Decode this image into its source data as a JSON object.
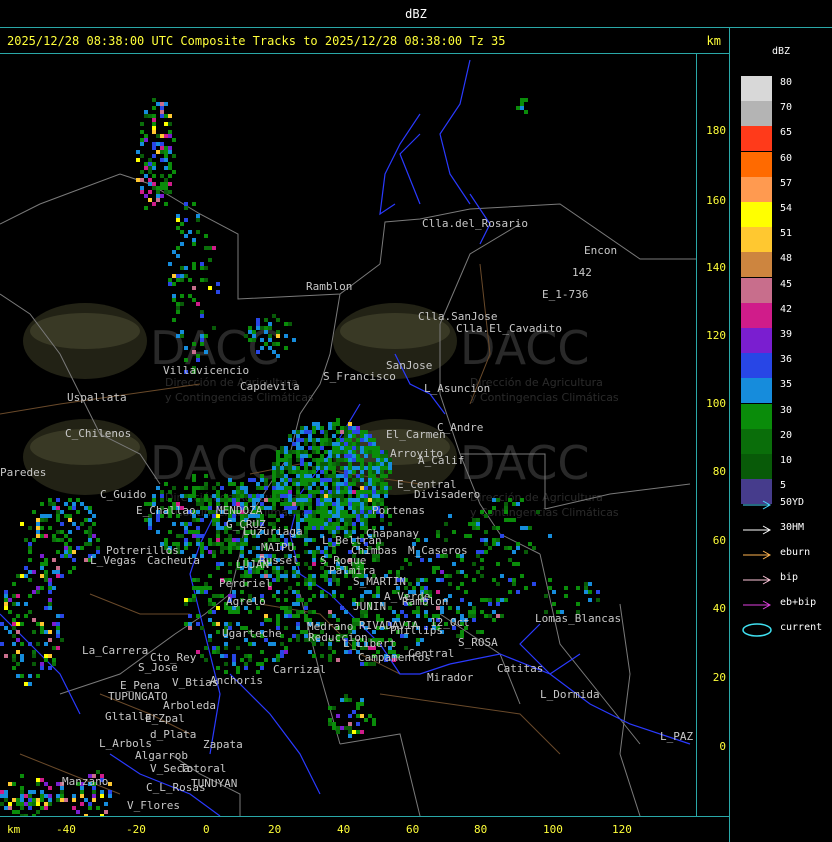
{
  "window": {
    "title": "dBZ"
  },
  "header": {
    "text": "2025/12/28 08:38:00 UTC Composite Tracks to 2025/12/28 08:38:00 Tz 35",
    "unit": "km"
  },
  "axes": {
    "y_ticks": [
      "180",
      "160",
      "140",
      "120",
      "100",
      "80",
      "60",
      "40",
      "20",
      "0"
    ],
    "x_ticks": [
      "-40",
      "-20",
      "0",
      "20",
      "40",
      "60",
      "80",
      "100",
      "120"
    ],
    "x_unit": "km"
  },
  "legend": {
    "title": "dBZ",
    "scale": [
      {
        "label": "80",
        "color": "#d8d8d8"
      },
      {
        "label": "70",
        "color": "#b4b4b4"
      },
      {
        "label": "65",
        "color": "#ff3a1a"
      },
      {
        "label": "60",
        "color": "#ff6a00"
      },
      {
        "label": "57",
        "color": "#ff9a50"
      },
      {
        "label": "54",
        "color": "#ffff00"
      },
      {
        "label": "51",
        "color": "#ffc830"
      },
      {
        "label": "48",
        "color": "#cd853f"
      },
      {
        "label": "45",
        "color": "#c86e8c"
      },
      {
        "label": "42",
        "color": "#d01c8a"
      },
      {
        "label": "39",
        "color": "#7a1ed0"
      },
      {
        "label": "36",
        "color": "#2846e6"
      },
      {
        "label": "35",
        "color": "#168cdc"
      },
      {
        "label": "30",
        "color": "#0a8c0a"
      },
      {
        "label": "20",
        "color": "#0a6e0a"
      },
      {
        "label": "10",
        "color": "#085a08"
      },
      {
        "label": "5",
        "color": "#463c8c"
      }
    ],
    "tracks": [
      {
        "label": "50YD",
        "color": "#4ad8ff"
      },
      {
        "label": "30HM",
        "color": "#ffffff"
      },
      {
        "label": "eburn",
        "color": "#ffb450"
      },
      {
        "label": "bip",
        "color": "#ffc8dc"
      },
      {
        "label": "eb+bip",
        "color": "#e040e0"
      },
      {
        "label": "current",
        "color": "#40e0f0"
      }
    ]
  },
  "watermark": {
    "brand": "DACC",
    "line1": "Dirección de Agricultura",
    "line2": "y Contingencias Climáticas"
  },
  "places": [
    {
      "name": "Clla.del_Rosario"
    },
    {
      "name": "Encon"
    },
    {
      "name": "142"
    },
    {
      "name": "E_1-736"
    },
    {
      "name": "Ramblon"
    },
    {
      "name": "Clla.SanJose"
    },
    {
      "name": "Clla.El_Cavadito"
    },
    {
      "name": "S_Francisco"
    },
    {
      "name": "Villavicencio"
    },
    {
      "name": "Capdevila"
    },
    {
      "name": "SanJose"
    },
    {
      "name": "L_Asuncion"
    },
    {
      "name": "Uspallata"
    },
    {
      "name": "C_Chilenos"
    },
    {
      "name": "C_Andre"
    },
    {
      "name": "El_Carmen"
    },
    {
      "name": "Arroyito"
    },
    {
      "name": "A_Calif"
    },
    {
      "name": "Paredes"
    },
    {
      "name": "C_Guido"
    },
    {
      "name": "Divisadero"
    },
    {
      "name": "E_Central"
    },
    {
      "name": "E_Challao"
    },
    {
      "name": "MENDOZA"
    },
    {
      "name": "Portenas"
    },
    {
      "name": "G_CRUZ"
    },
    {
      "name": "Luzuriaga"
    },
    {
      "name": "Chapanay"
    },
    {
      "name": "L_Beltran"
    },
    {
      "name": "Potrerillos"
    },
    {
      "name": "Chimbas"
    },
    {
      "name": "M_Caseros"
    },
    {
      "name": "L_Vegas"
    },
    {
      "name": "Cacheuta"
    },
    {
      "name": "MAIPU"
    },
    {
      "name": "Russel"
    },
    {
      "name": "S_Roque"
    },
    {
      "name": "LUJAN"
    },
    {
      "name": "Palmira"
    },
    {
      "name": "Perdriel"
    },
    {
      "name": "S_MARTIN"
    },
    {
      "name": "Agrelo"
    },
    {
      "name": "A_Verde"
    },
    {
      "name": "Ramblon"
    },
    {
      "name": "JUNIN"
    },
    {
      "name": "Ugarteche"
    },
    {
      "name": "RIVADAVIA"
    },
    {
      "name": "Phillips"
    },
    {
      "name": "12_Oct"
    },
    {
      "name": "Lomas_Blancas"
    },
    {
      "name": "Medrano"
    },
    {
      "name": "Reduccion"
    },
    {
      "name": "L_Libert"
    },
    {
      "name": "S_ROSA"
    },
    {
      "name": "La_Carrera"
    },
    {
      "name": "Cto_Rey"
    },
    {
      "name": "Campamentos"
    },
    {
      "name": "Central"
    },
    {
      "name": "Catitas"
    },
    {
      "name": "S_Jose"
    },
    {
      "name": "Carrizal"
    },
    {
      "name": "Anchoris"
    },
    {
      "name": "E_Pena"
    },
    {
      "name": "V_Btias"
    },
    {
      "name": "TUPUNGATO"
    },
    {
      "name": "Mirador"
    },
    {
      "name": "L_Dormida"
    },
    {
      "name": "Arboleda"
    },
    {
      "name": "Gltallar"
    },
    {
      "name": "E_Zpal"
    },
    {
      "name": "L_Arbols"
    },
    {
      "name": "d_Plata"
    },
    {
      "name": "Zapata"
    },
    {
      "name": "Algarrob"
    },
    {
      "name": "V_Seca"
    },
    {
      "name": "Totoral"
    },
    {
      "name": "TUNUYAN"
    },
    {
      "name": "C_L_Rosas"
    },
    {
      "name": "Manzano"
    },
    {
      "name": "V_Flores"
    },
    {
      "name": "L_PAZ"
    }
  ]
}
